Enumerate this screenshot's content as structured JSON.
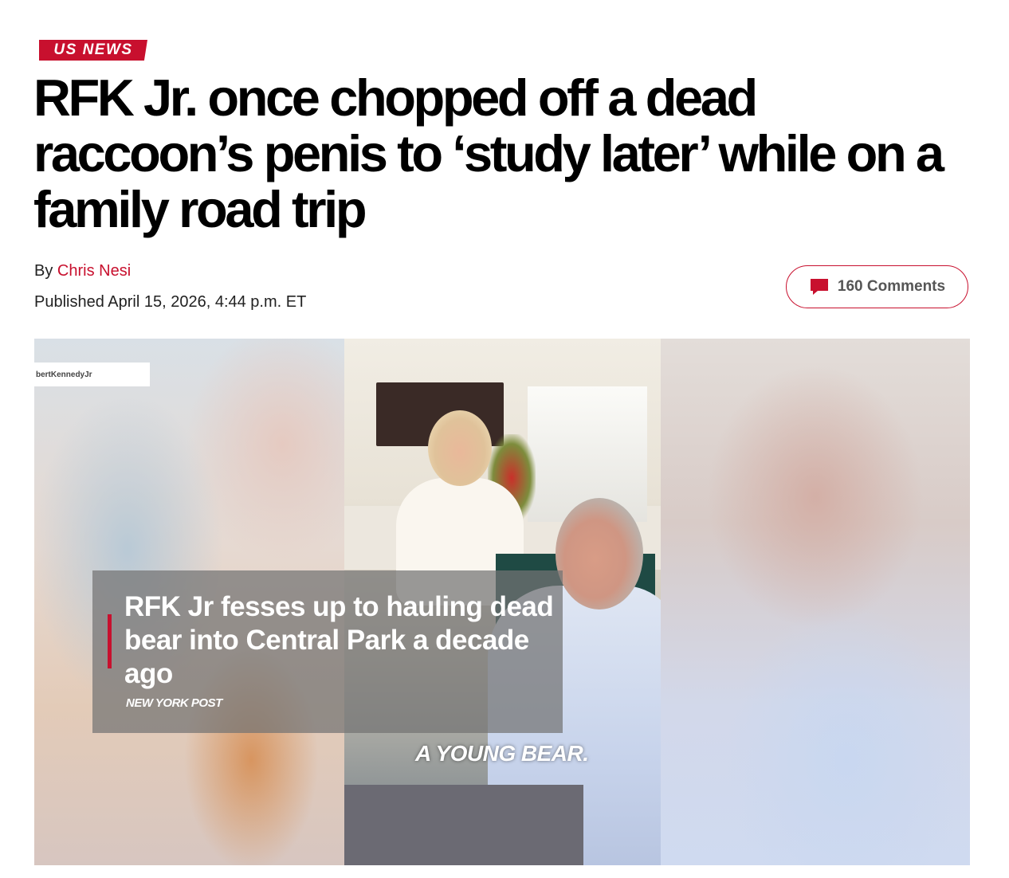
{
  "section": {
    "label": "US NEWS"
  },
  "article": {
    "headline": "RFK Jr. once chopped off a dead raccoon’s penis to ‘study later’ while on a family road trip",
    "byline_prefix": "By",
    "author": "Chris Nesi",
    "published": "Published April 15, 2026, 4:44 p.m. ET"
  },
  "comments": {
    "label": "160 Comments",
    "icon": "comment-bubble-icon"
  },
  "video": {
    "watermark": "bertKennedyJr",
    "overlay_title": "RFK Jr fesses up to hauling dead bear into Central Park a decade ago",
    "overlay_brand": "NEW YORK POST",
    "caption": "A YOUNG BEAR."
  },
  "colors": {
    "accent": "#c8102e",
    "text": "#000000"
  }
}
